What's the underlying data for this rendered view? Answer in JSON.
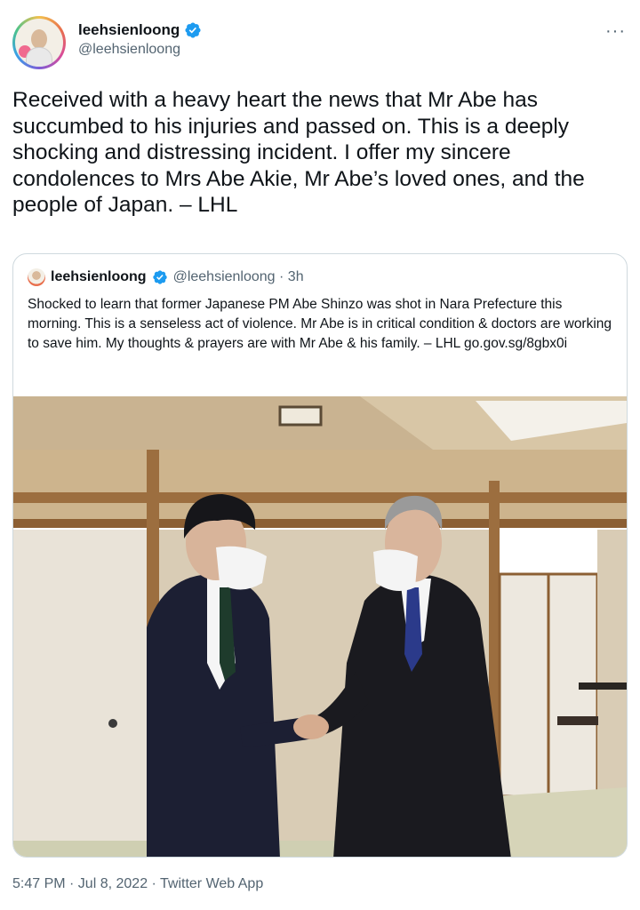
{
  "tweet": {
    "display_name": "leehsienloong",
    "handle": "@leehsienloong",
    "more_glyph": "···",
    "text": "Received with a heavy heart the news that Mr Abe has succumbed to his injuries and passed on. This is a deeply shocking and distressing incident. I offer my sincere condolences to Mrs Abe Akie, Mr Abe’s loved ones, and the people of Japan. – LHL",
    "timestamp": "5:47 PM · Jul 8, 2022 · Twitter Web App"
  },
  "quoted": {
    "display_name": "leehsienloong",
    "handle_time": "@leehsienloong · 3h",
    "text": "Shocked to learn that former Japanese PM Abe Shinzo was shot in Nara Prefecture this morning. This is a senseless act of violence. Mr Abe is in critical condition & doctors are working to save him. My thoughts & prayers are with Mr Abe & his family. – LHL go.gov.sg/8gbx0i"
  },
  "icons": {
    "verified": "verified-badge-icon",
    "more": "more-options-icon"
  },
  "colors": {
    "verified_blue": "#1d9bf0",
    "text_primary": "#0f1419",
    "text_secondary": "#536471",
    "border": "#cfd9de"
  }
}
